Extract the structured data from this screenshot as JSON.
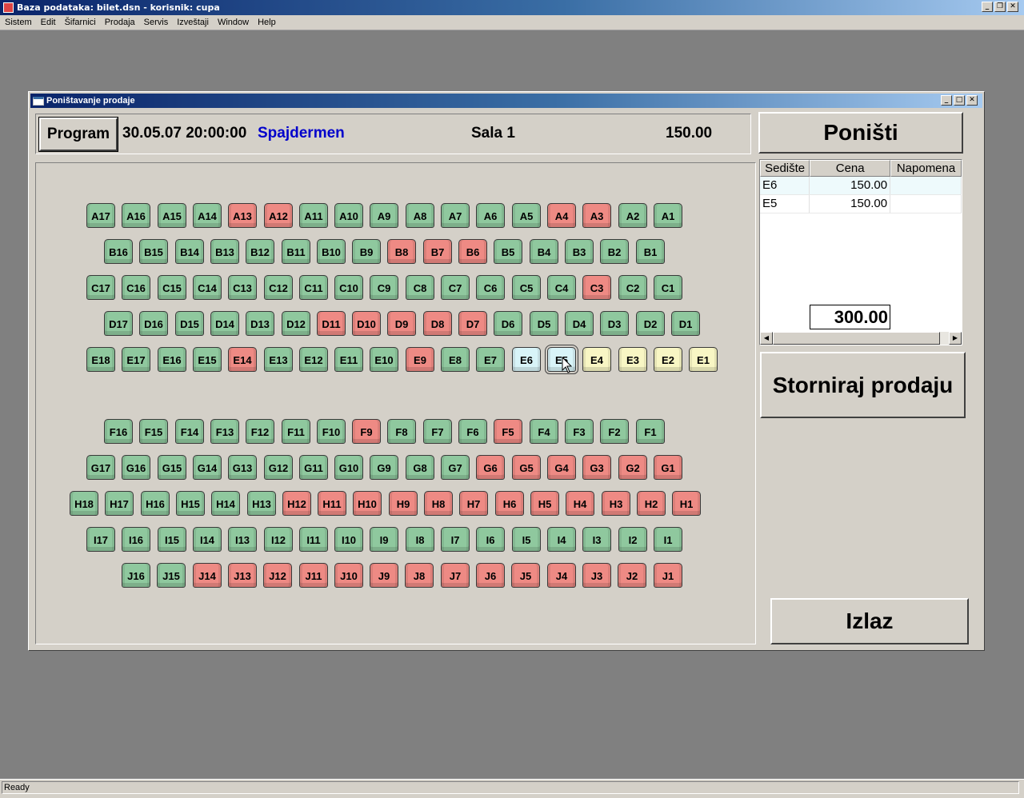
{
  "app": {
    "title": "Baza podataka: bilet.dsn  -  korisnik: cupa",
    "menu": [
      "Sistem",
      "Edit",
      "Šifarnici",
      "Prodaja",
      "Servis",
      "Izveštaji",
      "Window",
      "Help"
    ],
    "status": "Ready"
  },
  "dialog": {
    "title": "Poništavanje prodaje",
    "program_label": "Program",
    "datetime": "30.05.07 20:00:00",
    "movie": "Spajdermen",
    "hall": "Sala 1",
    "price": "150.00",
    "ponisti_label": "Poništi",
    "storno_label": "Storniraj prodaju",
    "izlaz_label": "Izlaz",
    "grid": {
      "columns": [
        "Sedište",
        "Cena",
        "Napomena"
      ],
      "rows": [
        {
          "seat": "E6",
          "price": "150.00",
          "note": ""
        },
        {
          "seat": "E5",
          "price": "150.00",
          "note": ""
        }
      ],
      "total": "300.00"
    }
  },
  "colors": {
    "free": "#8fc89e",
    "sold": "#ee8a84",
    "selected": "#d8f4f8",
    "reserved": "#f8f6c4",
    "movie": "#0000cc"
  },
  "seat_rows": [
    {
      "row": "A",
      "seats": [
        {
          "id": "A17",
          "s": "free"
        },
        {
          "id": "A16",
          "s": "free"
        },
        {
          "id": "A15",
          "s": "free"
        },
        {
          "id": "A14",
          "s": "free"
        },
        {
          "id": "A13",
          "s": "sold"
        },
        {
          "id": "A12",
          "s": "sold"
        },
        {
          "id": "A11",
          "s": "free"
        },
        {
          "id": "A10",
          "s": "free"
        },
        {
          "id": "A9",
          "s": "free"
        },
        {
          "id": "A8",
          "s": "free"
        },
        {
          "id": "A7",
          "s": "free"
        },
        {
          "id": "A6",
          "s": "free"
        },
        {
          "id": "A5",
          "s": "free"
        },
        {
          "id": "A4",
          "s": "sold"
        },
        {
          "id": "A3",
          "s": "sold"
        },
        {
          "id": "A2",
          "s": "free"
        },
        {
          "id": "A1",
          "s": "free"
        }
      ]
    },
    {
      "row": "B",
      "seats": [
        {
          "id": "B16",
          "s": "free"
        },
        {
          "id": "B15",
          "s": "free"
        },
        {
          "id": "B14",
          "s": "free"
        },
        {
          "id": "B13",
          "s": "free"
        },
        {
          "id": "B12",
          "s": "free"
        },
        {
          "id": "B11",
          "s": "free"
        },
        {
          "id": "B10",
          "s": "free"
        },
        {
          "id": "B9",
          "s": "free"
        },
        {
          "id": "B8",
          "s": "sold"
        },
        {
          "id": "B7",
          "s": "sold"
        },
        {
          "id": "B6",
          "s": "sold"
        },
        {
          "id": "B5",
          "s": "free"
        },
        {
          "id": "B4",
          "s": "free"
        },
        {
          "id": "B3",
          "s": "free"
        },
        {
          "id": "B2",
          "s": "free"
        },
        {
          "id": "B1",
          "s": "free"
        }
      ]
    },
    {
      "row": "C",
      "seats": [
        {
          "id": "C17",
          "s": "free"
        },
        {
          "id": "C16",
          "s": "free"
        },
        {
          "id": "C15",
          "s": "free"
        },
        {
          "id": "C14",
          "s": "free"
        },
        {
          "id": "C13",
          "s": "free"
        },
        {
          "id": "C12",
          "s": "free"
        },
        {
          "id": "C11",
          "s": "free"
        },
        {
          "id": "C10",
          "s": "free"
        },
        {
          "id": "C9",
          "s": "free"
        },
        {
          "id": "C8",
          "s": "free"
        },
        {
          "id": "C7",
          "s": "free"
        },
        {
          "id": "C6",
          "s": "free"
        },
        {
          "id": "C5",
          "s": "free"
        },
        {
          "id": "C4",
          "s": "free"
        },
        {
          "id": "C3",
          "s": "sold"
        },
        {
          "id": "C2",
          "s": "free"
        },
        {
          "id": "C1",
          "s": "free"
        }
      ]
    },
    {
      "row": "D",
      "seats": [
        {
          "id": "D17",
          "s": "free"
        },
        {
          "id": "D16",
          "s": "free"
        },
        {
          "id": "D15",
          "s": "free"
        },
        {
          "id": "D14",
          "s": "free"
        },
        {
          "id": "D13",
          "s": "free"
        },
        {
          "id": "D12",
          "s": "free"
        },
        {
          "id": "D11",
          "s": "sold"
        },
        {
          "id": "D10",
          "s": "sold"
        },
        {
          "id": "D9",
          "s": "sold"
        },
        {
          "id": "D8",
          "s": "sold"
        },
        {
          "id": "D7",
          "s": "sold"
        },
        {
          "id": "D6",
          "s": "free"
        },
        {
          "id": "D5",
          "s": "free"
        },
        {
          "id": "D4",
          "s": "free"
        },
        {
          "id": "D3",
          "s": "free"
        },
        {
          "id": "D2",
          "s": "free"
        },
        {
          "id": "D1",
          "s": "free"
        }
      ]
    },
    {
      "row": "E",
      "seats": [
        {
          "id": "E18",
          "s": "free"
        },
        {
          "id": "E17",
          "s": "free"
        },
        {
          "id": "E16",
          "s": "free"
        },
        {
          "id": "E15",
          "s": "free"
        },
        {
          "id": "E14",
          "s": "sold"
        },
        {
          "id": "E13",
          "s": "free"
        },
        {
          "id": "E12",
          "s": "free"
        },
        {
          "id": "E11",
          "s": "free"
        },
        {
          "id": "E10",
          "s": "free"
        },
        {
          "id": "E9",
          "s": "sold"
        },
        {
          "id": "E8",
          "s": "free"
        },
        {
          "id": "E7",
          "s": "free"
        },
        {
          "id": "E6",
          "s": "selected"
        },
        {
          "id": "E5",
          "s": "selected"
        },
        {
          "id": "E4",
          "s": "reserved"
        },
        {
          "id": "E3",
          "s": "reserved"
        },
        {
          "id": "E2",
          "s": "reserved"
        },
        {
          "id": "E1",
          "s": "reserved"
        }
      ]
    },
    {
      "row": "F",
      "seats": [
        {
          "id": "F16",
          "s": "free"
        },
        {
          "id": "F15",
          "s": "free"
        },
        {
          "id": "F14",
          "s": "free"
        },
        {
          "id": "F13",
          "s": "free"
        },
        {
          "id": "F12",
          "s": "free"
        },
        {
          "id": "F11",
          "s": "free"
        },
        {
          "id": "F10",
          "s": "free"
        },
        {
          "id": "F9",
          "s": "sold"
        },
        {
          "id": "F8",
          "s": "free"
        },
        {
          "id": "F7",
          "s": "free"
        },
        {
          "id": "F6",
          "s": "free"
        },
        {
          "id": "F5",
          "s": "sold"
        },
        {
          "id": "F4",
          "s": "free"
        },
        {
          "id": "F3",
          "s": "free"
        },
        {
          "id": "F2",
          "s": "free"
        },
        {
          "id": "F1",
          "s": "free"
        }
      ]
    },
    {
      "row": "G",
      "seats": [
        {
          "id": "G17",
          "s": "free"
        },
        {
          "id": "G16",
          "s": "free"
        },
        {
          "id": "G15",
          "s": "free"
        },
        {
          "id": "G14",
          "s": "free"
        },
        {
          "id": "G13",
          "s": "free"
        },
        {
          "id": "G12",
          "s": "free"
        },
        {
          "id": "G11",
          "s": "free"
        },
        {
          "id": "G10",
          "s": "free"
        },
        {
          "id": "G9",
          "s": "free"
        },
        {
          "id": "G8",
          "s": "free"
        },
        {
          "id": "G7",
          "s": "free"
        },
        {
          "id": "G6",
          "s": "sold"
        },
        {
          "id": "G5",
          "s": "sold"
        },
        {
          "id": "G4",
          "s": "sold"
        },
        {
          "id": "G3",
          "s": "sold"
        },
        {
          "id": "G2",
          "s": "sold"
        },
        {
          "id": "G1",
          "s": "sold"
        }
      ]
    },
    {
      "row": "H",
      "seats": [
        {
          "id": "H18",
          "s": "free"
        },
        {
          "id": "H17",
          "s": "free"
        },
        {
          "id": "H16",
          "s": "free"
        },
        {
          "id": "H15",
          "s": "free"
        },
        {
          "id": "H14",
          "s": "free"
        },
        {
          "id": "H13",
          "s": "free"
        },
        {
          "id": "H12",
          "s": "sold"
        },
        {
          "id": "H11",
          "s": "sold"
        },
        {
          "id": "H10",
          "s": "sold"
        },
        {
          "id": "H9",
          "s": "sold"
        },
        {
          "id": "H8",
          "s": "sold"
        },
        {
          "id": "H7",
          "s": "sold"
        },
        {
          "id": "H6",
          "s": "sold"
        },
        {
          "id": "H5",
          "s": "sold"
        },
        {
          "id": "H4",
          "s": "sold"
        },
        {
          "id": "H3",
          "s": "sold"
        },
        {
          "id": "H2",
          "s": "sold"
        },
        {
          "id": "H1",
          "s": "sold"
        }
      ]
    },
    {
      "row": "I",
      "seats": [
        {
          "id": "I17",
          "s": "free"
        },
        {
          "id": "I16",
          "s": "free"
        },
        {
          "id": "I15",
          "s": "free"
        },
        {
          "id": "I14",
          "s": "free"
        },
        {
          "id": "I13",
          "s": "free"
        },
        {
          "id": "I12",
          "s": "free"
        },
        {
          "id": "I11",
          "s": "free"
        },
        {
          "id": "I10",
          "s": "free"
        },
        {
          "id": "I9",
          "s": "free"
        },
        {
          "id": "I8",
          "s": "free"
        },
        {
          "id": "I7",
          "s": "free"
        },
        {
          "id": "I6",
          "s": "free"
        },
        {
          "id": "I5",
          "s": "free"
        },
        {
          "id": "I4",
          "s": "free"
        },
        {
          "id": "I3",
          "s": "free"
        },
        {
          "id": "I2",
          "s": "free"
        },
        {
          "id": "I1",
          "s": "free"
        }
      ]
    },
    {
      "row": "J",
      "seats": [
        {
          "id": "J16",
          "s": "free"
        },
        {
          "id": "J15",
          "s": "free"
        },
        {
          "id": "J14",
          "s": "sold"
        },
        {
          "id": "J13",
          "s": "sold"
        },
        {
          "id": "J12",
          "s": "sold"
        },
        {
          "id": "J11",
          "s": "sold"
        },
        {
          "id": "J10",
          "s": "sold"
        },
        {
          "id": "J9",
          "s": "sold"
        },
        {
          "id": "J8",
          "s": "sold"
        },
        {
          "id": "J7",
          "s": "sold"
        },
        {
          "id": "J6",
          "s": "sold"
        },
        {
          "id": "J5",
          "s": "sold"
        },
        {
          "id": "J4",
          "s": "sold"
        },
        {
          "id": "J3",
          "s": "sold"
        },
        {
          "id": "J2",
          "s": "sold"
        },
        {
          "id": "J1",
          "s": "sold"
        }
      ]
    }
  ]
}
